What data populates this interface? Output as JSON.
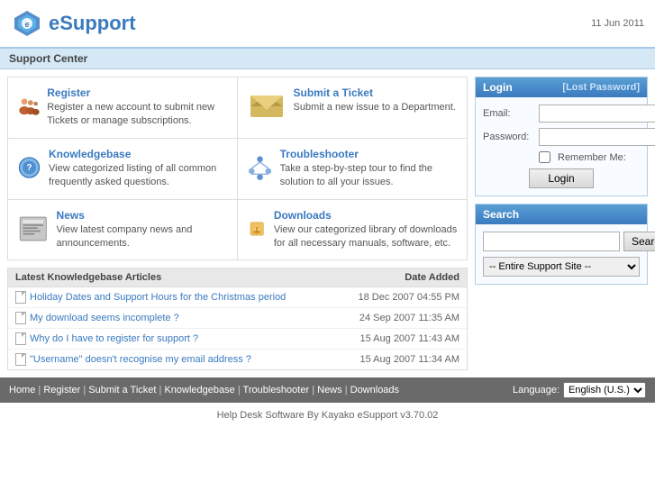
{
  "header": {
    "logo_text": "eSupport",
    "date": "11 Jun 2011"
  },
  "support_bar": {
    "title": "Support Center"
  },
  "features": [
    {
      "id": "register",
      "title": "Register",
      "description": "Register a new account to submit new Tickets or manage subscriptions.",
      "icon_type": "register"
    },
    {
      "id": "submit-ticket",
      "title": "Submit a Ticket",
      "description": "Submit a new issue to a Department.",
      "icon_type": "ticket"
    },
    {
      "id": "knowledgebase",
      "title": "Knowledgebase",
      "description": "View categorized listing of all common frequently asked questions.",
      "icon_type": "kb"
    },
    {
      "id": "troubleshooter",
      "title": "Troubleshooter",
      "description": "Take a step-by-step tour to find the solution to all your issues.",
      "icon_type": "trouble"
    },
    {
      "id": "news",
      "title": "News",
      "description": "View latest company news and announcements.",
      "icon_type": "news"
    },
    {
      "id": "downloads",
      "title": "Downloads",
      "description": "View our categorized library of downloads for all necessary manuals, software, etc.",
      "icon_type": "dl"
    }
  ],
  "kb_section": {
    "header_left": "Latest Knowledgebase Articles",
    "header_right": "Date Added",
    "articles": [
      {
        "title": "Holiday Dates and Support Hours for the Christmas period",
        "date": "18 Dec 2007 04:55 PM"
      },
      {
        "title": "My download seems incomplete ?",
        "date": "24 Sep 2007 11:35 AM"
      },
      {
        "title": "Why do I have to register for support ?",
        "date": "15 Aug 2007 11:43 AM"
      },
      {
        "title": "\"Username\" doesn't recognise my email address ?",
        "date": "15 Aug 2007 11:34 AM"
      }
    ]
  },
  "login": {
    "header": "Login",
    "lost_password": "[Lost Password]",
    "email_label": "Email:",
    "password_label": "Password:",
    "remember_label": "Remember Me:",
    "button_label": "Login"
  },
  "search": {
    "header": "Search",
    "button_label": "Search",
    "select_default": "-- Entire Support Site --"
  },
  "footer_nav": {
    "links": [
      "Home",
      "Register",
      "Submit a Ticket",
      "Knowledgebase",
      "Troubleshooter",
      "News",
      "Downloads"
    ],
    "language_label": "Language:",
    "language_value": "English (U.S.)"
  },
  "bottom_footer": {
    "text": "Help Desk Software By Kayako eSupport v3.70.02"
  }
}
